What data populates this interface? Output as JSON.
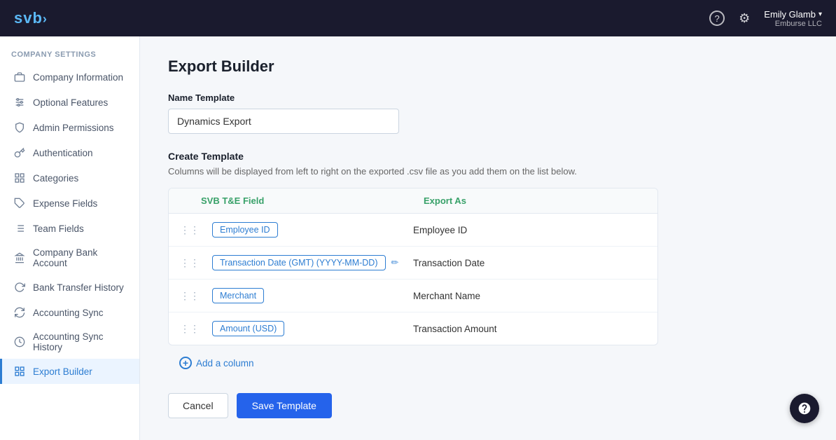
{
  "topnav": {
    "logo": "svb",
    "logo_arrow": "›",
    "help_icon": "?",
    "gear_icon": "⚙",
    "user_name": "Emily Glamb",
    "user_company": "Emburse LLC",
    "chevron": "▾"
  },
  "sidebar": {
    "section_label": "COMPANY SETTINGS",
    "items": [
      {
        "id": "company-information",
        "label": "Company Information",
        "icon": "briefcase",
        "active": false
      },
      {
        "id": "optional-features",
        "label": "Optional Features",
        "icon": "sliders",
        "active": false
      },
      {
        "id": "admin-permissions",
        "label": "Admin Permissions",
        "icon": "shield",
        "active": false
      },
      {
        "id": "authentication",
        "label": "Authentication",
        "icon": "key",
        "active": false
      },
      {
        "id": "categories",
        "label": "Categories",
        "icon": "grid",
        "active": false
      },
      {
        "id": "expense-fields",
        "label": "Expense Fields",
        "icon": "tag",
        "active": false
      },
      {
        "id": "team-fields",
        "label": "Team Fields",
        "icon": "list",
        "active": false
      },
      {
        "id": "company-bank-account",
        "label": "Company Bank Account",
        "icon": "bank",
        "active": false
      },
      {
        "id": "bank-transfer-history",
        "label": "Bank Transfer History",
        "icon": "refresh",
        "active": false
      },
      {
        "id": "accounting-sync",
        "label": "Accounting Sync",
        "icon": "sync",
        "active": false
      },
      {
        "id": "accounting-sync-history",
        "label": "Accounting Sync History",
        "icon": "clock",
        "active": false
      },
      {
        "id": "export-builder",
        "label": "Export Builder",
        "icon": "export",
        "active": true
      }
    ]
  },
  "main": {
    "page_title": "Export Builder",
    "name_template_label": "Name Template",
    "name_template_value": "Dynamics Export",
    "name_template_placeholder": "Dynamics Export",
    "create_template_title": "Create Template",
    "create_template_desc": "Columns will be displayed from left to right on the exported .csv file as you add them on the list below.",
    "table": {
      "col_field": "SVB T&E Field",
      "col_export": "Export As",
      "rows": [
        {
          "field": "Employee ID",
          "export_as": "Employee ID",
          "has_edit": false
        },
        {
          "field": "Transaction Date (GMT) (YYYY-MM-DD)",
          "export_as": "Transaction Date",
          "has_edit": true
        },
        {
          "field": "Merchant",
          "export_as": "Merchant Name",
          "has_edit": false
        },
        {
          "field": "Amount (USD)",
          "export_as": "Transaction Amount",
          "has_edit": false
        }
      ]
    },
    "add_column_label": "Add a column",
    "cancel_label": "Cancel",
    "save_label": "Save Template"
  },
  "icons": {
    "briefcase": "💼",
    "sliders": "⊞",
    "shield": "🛡",
    "key": "🔑",
    "grid": "⊞",
    "tag": "🏷",
    "list": "≡",
    "bank": "🏦",
    "refresh": "↺",
    "sync": "↻",
    "clock": "🕐",
    "export": "⊞",
    "drag": "⋮⋮",
    "edit": "✏",
    "plus": "+"
  }
}
